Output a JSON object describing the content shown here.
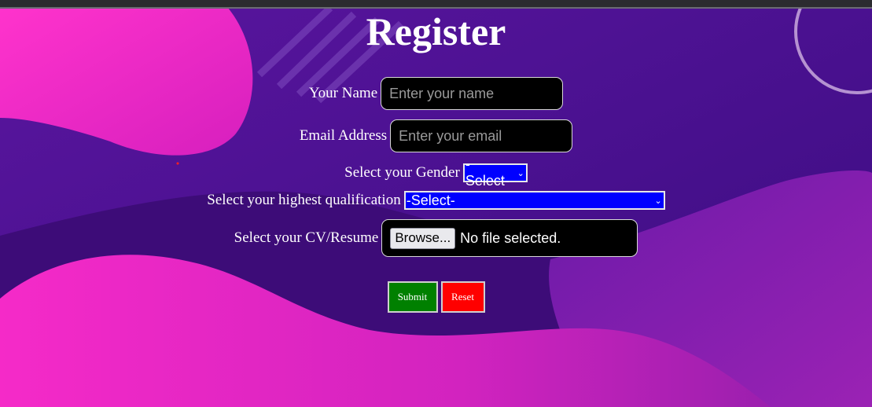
{
  "form": {
    "title": "Register",
    "name_label": "Your Name",
    "name_placeholder": "Enter your name",
    "email_label": "Email Address",
    "email_placeholder": "Enter your email",
    "gender_label": "Select your Gender",
    "gender_selected": "-Select-",
    "qualification_label": "Select your highest qualification",
    "qualification_selected": "-Select-",
    "cv_label": "Select your CV/Resume",
    "browse_label": "Browse...",
    "file_status": "No file selected.",
    "submit_label": "Submit",
    "reset_label": "Reset"
  },
  "colors": {
    "background": "#4a148c",
    "blob": "#f22bc9",
    "select_bg": "#0000ff",
    "submit_bg": "#008000",
    "reset_bg": "#ff0000"
  }
}
